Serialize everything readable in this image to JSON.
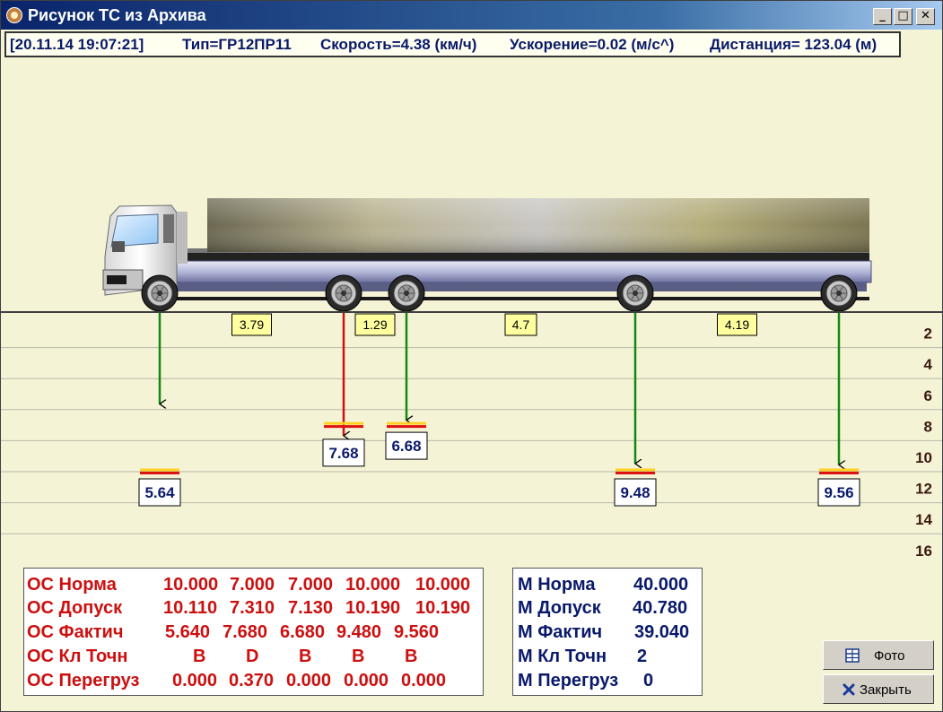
{
  "window": {
    "title": "Рисунок ТС из Архива",
    "controls": [
      "_",
      "□",
      "✕"
    ]
  },
  "info": {
    "datetime": "[20.11.14 19:07:21]",
    "type": "Тип=ГР12ПР11",
    "speed": "Скорость=4.38 (км/ч)",
    "accel": "Ускорение=0.02 (м/с^)",
    "distance": "Дистанция= 123.04 (м)"
  },
  "scale_labels": [
    "2",
    "4",
    "6",
    "8",
    "10",
    "12",
    "14",
    "16"
  ],
  "axle_spacings": [
    "3.79",
    "1.29",
    "4.7",
    "4.19"
  ],
  "axles": [
    {
      "value": "5.64",
      "load": 5.64,
      "norm": 10.0,
      "tolerance": 10.11,
      "overload": false
    },
    {
      "value": "7.68",
      "load": 7.68,
      "norm": 7.0,
      "tolerance": 7.31,
      "overload": true
    },
    {
      "value": "6.68",
      "load": 6.68,
      "norm": 7.0,
      "tolerance": 7.13,
      "overload": false
    },
    {
      "value": "9.48",
      "load": 9.48,
      "norm": 10.0,
      "tolerance": 10.19,
      "overload": false
    },
    {
      "value": "9.56",
      "load": 9.56,
      "norm": 10.0,
      "tolerance": 10.19,
      "overload": false
    }
  ],
  "axle_table": {
    "rows": [
      {
        "label": "ОС Норма",
        "values": [
          "10.000",
          "7.000",
          "7.000",
          "10.000",
          "10.000"
        ]
      },
      {
        "label": "ОС Допуск",
        "values": [
          "10.110",
          "7.310",
          "7.130",
          "10.190",
          "10.190"
        ]
      },
      {
        "label": "ОС Фактич",
        "values": [
          "5.640",
          "7.680",
          "6.680",
          "9.480",
          "9.560"
        ]
      },
      {
        "label": "ОС Кл Точн",
        "values": [
          "B",
          "D",
          "B",
          "B",
          "B"
        ]
      },
      {
        "label": "ОС Перегруз",
        "values": [
          "0.000",
          "0.370",
          "0.000",
          "0.000",
          "0.000"
        ]
      }
    ]
  },
  "mass_table": {
    "rows": [
      {
        "label": "М Норма",
        "value": "40.000"
      },
      {
        "label": "М Допуск",
        "value": "40.780"
      },
      {
        "label": "М Фактич",
        "value": "39.040"
      },
      {
        "label": "М Кл Точн",
        "value": "2"
      },
      {
        "label": "М Перегруз",
        "value": "0"
      }
    ]
  },
  "buttons": {
    "photo": "Фото",
    "close": "Закрыть"
  },
  "colors": {
    "ok_arrow": "#118811",
    "overload_arrow": "#cc1111",
    "norm_marker": "#ffd020",
    "tolerance_marker": "#dd1111"
  }
}
